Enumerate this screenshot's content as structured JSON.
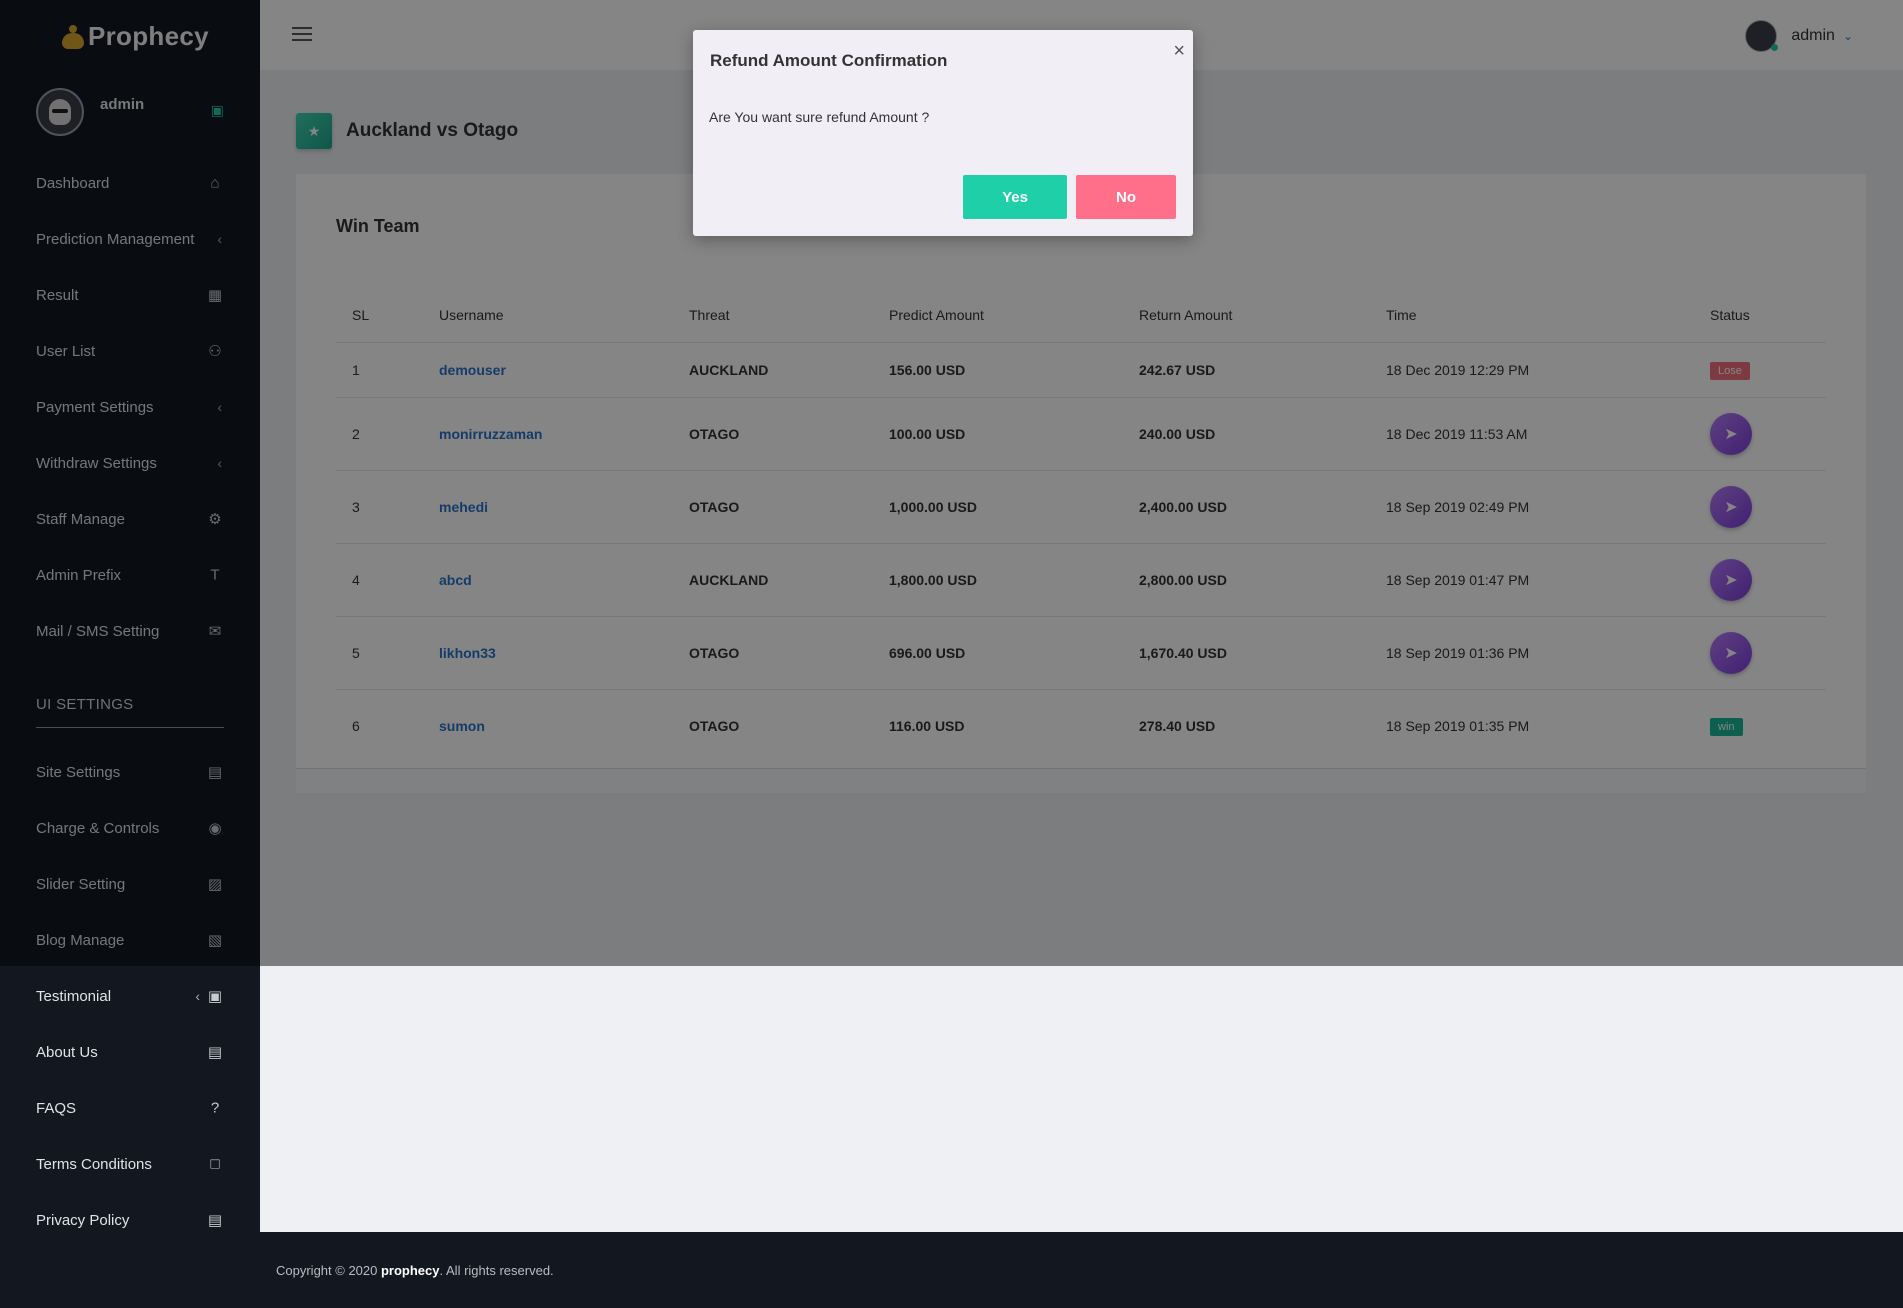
{
  "brand": {
    "name": "Prophecy",
    "logo_icon": "money-bag-icon"
  },
  "profile": {
    "name": "admin",
    "badge_icon": "bookmark-icon"
  },
  "sidebar": {
    "items": [
      {
        "label": "Dashboard",
        "icon": "home-icon"
      },
      {
        "label": "Prediction Management",
        "icon": "chevron-left-icon"
      },
      {
        "label": "Result",
        "icon": "table-icon"
      },
      {
        "label": "User List",
        "icon": "users-icon"
      },
      {
        "label": "Payment Settings",
        "icon": "chevron-left-icon"
      },
      {
        "label": "Withdraw Settings",
        "icon": "chevron-left-icon"
      },
      {
        "label": "Staff Manage",
        "icon": "user-cog-icon"
      },
      {
        "label": "Admin Prefix",
        "icon": "text-icon"
      },
      {
        "label": "Mail / SMS Setting",
        "icon": "envelope-icon"
      }
    ],
    "section_title": "UI SETTINGS",
    "ui_items": [
      {
        "label": "Site Settings",
        "icon": "file-icon"
      },
      {
        "label": "Charge & Controls",
        "icon": "gamepad-icon"
      },
      {
        "label": "Slider Setting",
        "icon": "image-icon"
      },
      {
        "label": "Blog Manage",
        "icon": "blog-icon"
      },
      {
        "label": "Testimonial",
        "icon": "ticket-icon"
      },
      {
        "label": "About Us",
        "icon": "file-text-icon"
      },
      {
        "label": "FAQS",
        "icon": "question-icon"
      },
      {
        "label": "Terms Conditions",
        "icon": "file-outline-icon"
      },
      {
        "label": "Privacy Policy",
        "icon": "policy-icon"
      }
    ]
  },
  "topbar": {
    "user_name": "admin"
  },
  "page": {
    "title": "Auckland vs Otago"
  },
  "card": {
    "title": "Win Team",
    "columns": [
      "SL",
      "Username",
      "Threat",
      "Predict Amount",
      "Return Amount",
      "Time",
      "Status"
    ],
    "rows": [
      {
        "sl": "1",
        "username": "demouser",
        "threat": "AUCKLAND",
        "predict": "156.00 USD",
        "return": "242.67 USD",
        "time": "18 Dec 2019 12:29 PM",
        "status": "Lose"
      },
      {
        "sl": "2",
        "username": "monirruzzaman",
        "threat": "OTAGO",
        "predict": "100.00 USD",
        "return": "240.00 USD",
        "time": "18 Dec 2019 11:53 AM",
        "status": "send"
      },
      {
        "sl": "3",
        "username": "mehedi",
        "threat": "OTAGO",
        "predict": "1,000.00 USD",
        "return": "2,400.00 USD",
        "time": "18 Sep 2019 02:49 PM",
        "status": "send"
      },
      {
        "sl": "4",
        "username": "abcd",
        "threat": "AUCKLAND",
        "predict": "1,800.00 USD",
        "return": "2,800.00 USD",
        "time": "18 Sep 2019 01:47 PM",
        "status": "send"
      },
      {
        "sl": "5",
        "username": "likhon33",
        "threat": "OTAGO",
        "predict": "696.00 USD",
        "return": "1,670.40 USD",
        "time": "18 Sep 2019 01:36 PM",
        "status": "send"
      },
      {
        "sl": "6",
        "username": "sumon",
        "threat": "OTAGO",
        "predict": "116.00 USD",
        "return": "278.40 USD",
        "time": "18 Sep 2019 01:35 PM",
        "status": "win"
      }
    ]
  },
  "footer": {
    "prefix": "Copyright © 2020 ",
    "brand": "prophecy",
    "suffix": ". All rights reserved."
  },
  "modal": {
    "title": "Refund Amount Confirmation",
    "close": "×",
    "body": "Are You want sure refund Amount ?",
    "yes": "Yes",
    "no": "No"
  },
  "colors": {
    "accent": "#1fcfa8",
    "danger": "#ff6f8a",
    "sidebar": "#13171f",
    "link": "#2a73c9",
    "purple": "#8e4fe6"
  }
}
